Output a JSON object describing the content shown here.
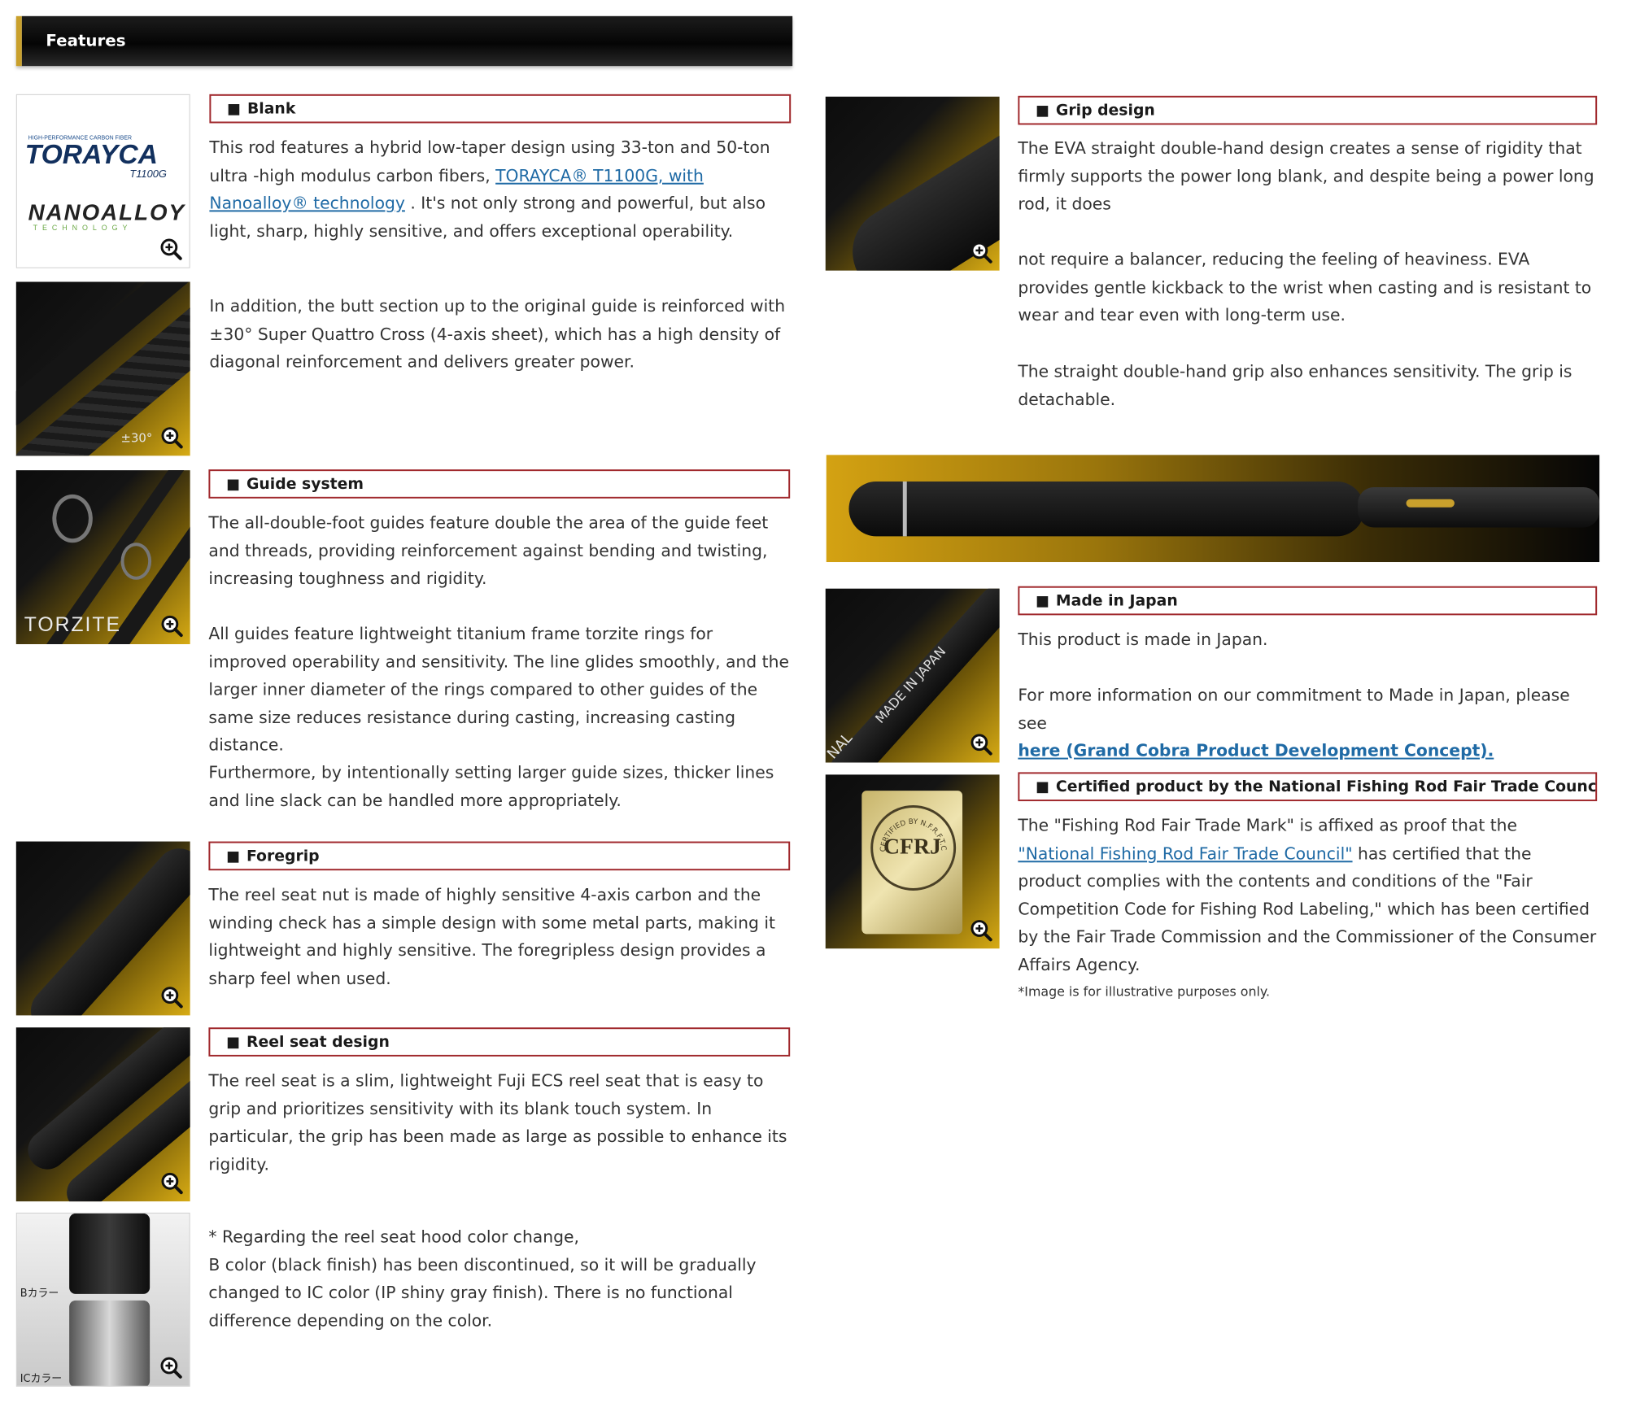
{
  "header": {
    "title": "Features"
  },
  "left": {
    "blank": {
      "heading": "Blank",
      "image": {
        "logo_top_small": "HIGH-PERFORMANCE CARBON FIBER",
        "logo_main": "TORAYCA",
        "logo_sub": "T1100G",
        "logo_brand": "NANOALLOY",
        "logo_brand_sub": "TECHNOLOGY"
      },
      "p1_before": "This rod features a hybrid low-taper design using 33-ton and 50-ton ultra -high modulus carbon fibers, ",
      "p1_link": "TORAYCA® T1100G, with Nanoalloy® technology",
      "p1_after": " . It's not only strong and powerful, but also light, sharp, highly sensitive, and offers exceptional operability.",
      "p2": "In addition, the butt section up to the original guide is reinforced with ±30°  Super Quattro Cross (4-axis sheet), which has a high density of diagonal reinforcement and delivers greater power.",
      "image2_label": "±30°"
    },
    "guide": {
      "heading": "Guide system",
      "image_label": "TORZITE",
      "p1": "The all-double-foot guides feature double the area of the guide feet and threads, providing reinforcement against bending and twisting, increasing toughness and rigidity.",
      "p2": "All guides feature lightweight titanium frame torzite rings for improved operability and sensitivity. The line glides smoothly, and the larger inner diameter of the rings compared to other guides of the same size reduces resistance during casting, increasing casting distance.",
      "p3": "Furthermore, by intentionally setting larger guide sizes, thicker lines and line slack can be handled more appropriately."
    },
    "foregrip": {
      "heading": "Foregrip",
      "p1": "The reel seat nut is made of highly sensitive 4-axis carbon and the winding check has a simple design with some metal parts, making it lightweight and highly sensitive. The foregripless design provides a sharp feel when used."
    },
    "reelseat": {
      "heading": "Reel seat design",
      "p1": "The reel seat is a slim, lightweight Fuji ECS reel seat that is easy to grip and prioritizes sensitivity with its blank touch system. In particular, the grip has been made as large as possible to enhance its rigidity.",
      "note_lines": [
        "* Regarding the reel seat hood color change,",
        "B color (black finish) has been discontinued, so it will be gradually changed to IC color (IP shiny gray finish). There is no functional difference depending on the color."
      ],
      "image_label_b": "Bカラー",
      "image_label_ic": "ICカラー"
    }
  },
  "right": {
    "grip": {
      "heading": "Grip design",
      "p1": "The EVA straight double-hand design creates a sense of rigidity that firmly supports the power long blank, and despite being a power long rod, it does",
      "p2": "not require a balancer, reducing the feeling of heaviness. EVA provides gentle kickback to the wrist when casting and is resistant to wear and tear even with long-term use.",
      "p3": "The straight double-hand grip also enhances sensitivity. The grip is detachable."
    },
    "japan": {
      "heading": "Made in Japan",
      "image_label": "MADE IN JAPAN",
      "image_label_edge": "NAL",
      "p1": "This product is made in Japan.",
      "p2": "For more information on our commitment to Made in Japan, please see",
      "link": "here (Grand Cobra Product Development Concept)."
    },
    "certified": {
      "heading": "Certified product by the National Fishing Rod Fair Trade Council",
      "image_label": "CFRJ",
      "image_ring": "CERTIFIED BY N.F.R.F.T.C",
      "p1_before": "The \"Fishing Rod Fair Trade Mark\" is affixed as proof that the ",
      "p1_link": "\"National Fishing Rod Fair Trade Council\"",
      "p1_after": " has certified that the product complies with the contents and conditions of the \"Fair Competition Code for Fishing Rod Labeling,\" which has been certified by the Fair Trade Commission and the Commissioner of the Consumer Affairs Agency.",
      "footnote": "*Image is for illustrative purposes only."
    }
  },
  "icons": {
    "zoom": "zoom-in-magnifier-icon"
  },
  "colors": {
    "heading_border": "#a0282c",
    "link": "#1f6aa5",
    "accent_gold": "#d7ab14"
  }
}
